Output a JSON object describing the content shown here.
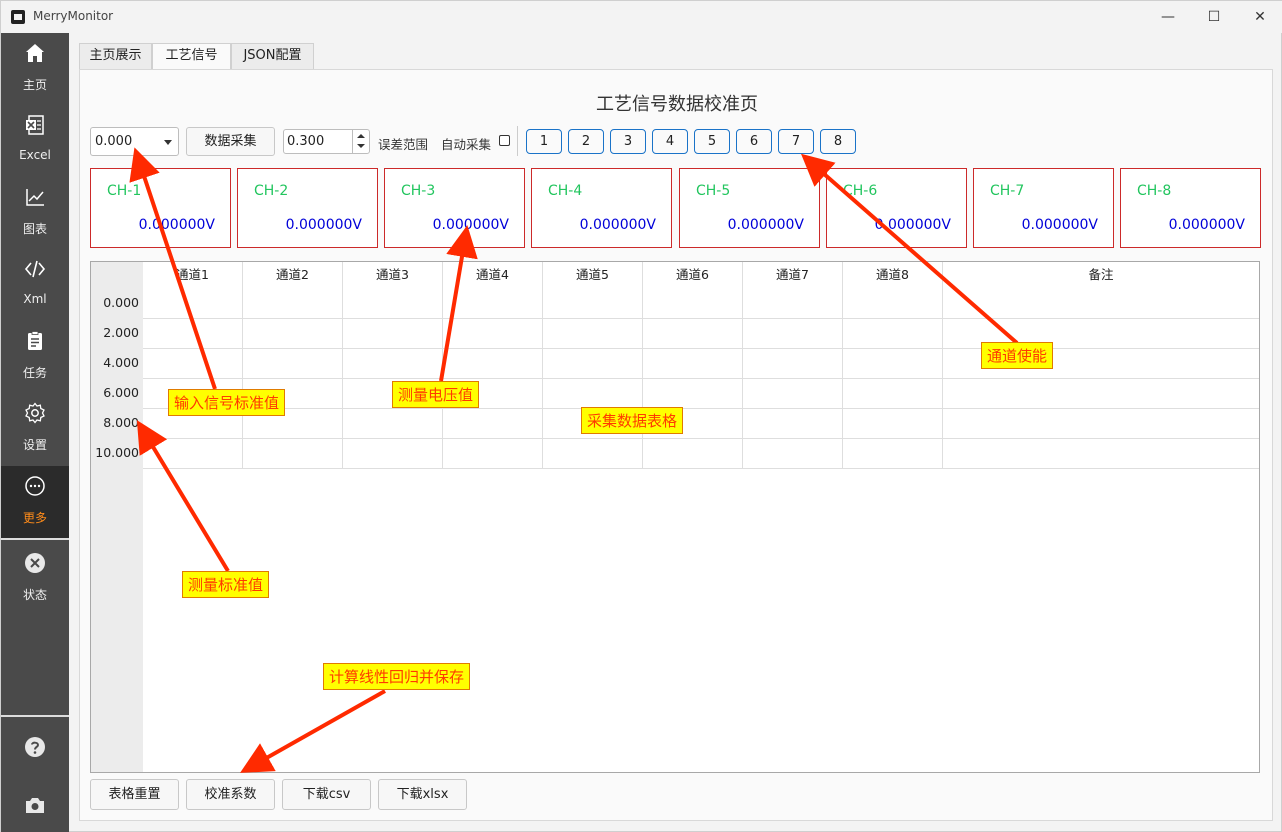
{
  "window": {
    "title": "MerryMonitor",
    "min_glyph": "—",
    "max_glyph": "☐",
    "close_glyph": "✕"
  },
  "sidebar": {
    "items": [
      {
        "label": "主页"
      },
      {
        "label": "Excel"
      },
      {
        "label": "图表"
      },
      {
        "label": "Xml"
      },
      {
        "label": "任务"
      },
      {
        "label": "设置"
      },
      {
        "label": "更多"
      },
      {
        "label": "状态"
      }
    ],
    "active_color": "#ff8c1a"
  },
  "tabs": [
    {
      "label": "主页展示"
    },
    {
      "label": "工艺信号"
    },
    {
      "label": "JSON配置"
    }
  ],
  "page": {
    "title": "工艺信号数据校准页",
    "std_select_value": "0.000",
    "collect_label": "数据采集",
    "tolerance_value": "0.300",
    "tolerance_label": "误差范围",
    "auto_label": "自动采集",
    "channel_buttons": [
      "1",
      "2",
      "3",
      "4",
      "5",
      "6",
      "7",
      "8"
    ],
    "cards": [
      {
        "name": "CH-1",
        "value": "0.000000V"
      },
      {
        "name": "CH-2",
        "value": "0.000000V"
      },
      {
        "name": "CH-3",
        "value": "0.000000V"
      },
      {
        "name": "CH-4",
        "value": "0.000000V"
      },
      {
        "name": "CH-5",
        "value": "0.000000V"
      },
      {
        "name": "CH-6",
        "value": "0.000000V"
      },
      {
        "name": "CH-7",
        "value": "0.000000V"
      },
      {
        "name": "CH-8",
        "value": "0.000000V"
      }
    ],
    "table": {
      "columns": [
        "通道1",
        "通道2",
        "通道3",
        "通道4",
        "通道5",
        "通道6",
        "通道7",
        "通道8",
        "备注"
      ],
      "rows": [
        "0.000",
        "2.000",
        "4.000",
        "6.000",
        "8.000",
        "10.000"
      ]
    },
    "bottom_buttons": [
      "表格重置",
      "校准系数",
      "下载csv",
      "下载xlsx"
    ]
  },
  "annotations": {
    "input_std": "输入信号标准值",
    "measured_voltage": "测量电压值",
    "table": "采集数据表格",
    "channel_enable": "通道使能",
    "measured_std": "测量标准值",
    "regression": "计算线性回归并保存"
  },
  "colors": {
    "card_border": "#cc2a2a",
    "channel_name": "#22c55e",
    "channel_value": "#0000d8",
    "channel_btn_border": "#1a73c8",
    "annotation_bg": "#ffff00",
    "annotation_text": "#ff3b00",
    "arrow": "#ff2a00"
  }
}
